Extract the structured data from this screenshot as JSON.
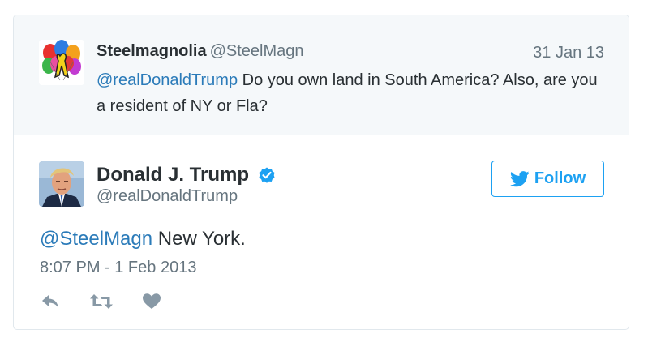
{
  "reply_context": {
    "name": "Steelmagnolia",
    "handle": "@SteelMagn",
    "date": "31 Jan 13",
    "mention": "@realDonaldTrump",
    "text": " Do you own land in South America? Also, are you a resident of NY or Fla?"
  },
  "tweet": {
    "name": "Donald J. Trump",
    "handle": "@realDonaldTrump",
    "mention": "@SteelMagn",
    "text": " New York.",
    "timestamp": "8:07 PM - 1 Feb 2013"
  },
  "follow_button": {
    "label": "Follow"
  },
  "icons": {
    "verified": "verified-badge-icon",
    "reply": "reply-icon",
    "retweet": "retweet-icon",
    "like": "heart-icon",
    "follow": "twitter-bird-icon"
  },
  "colors": {
    "link": "#2b7bb9",
    "accent": "#1da1f2",
    "muted": "#66757f",
    "context_bg": "#f5f8fa"
  }
}
